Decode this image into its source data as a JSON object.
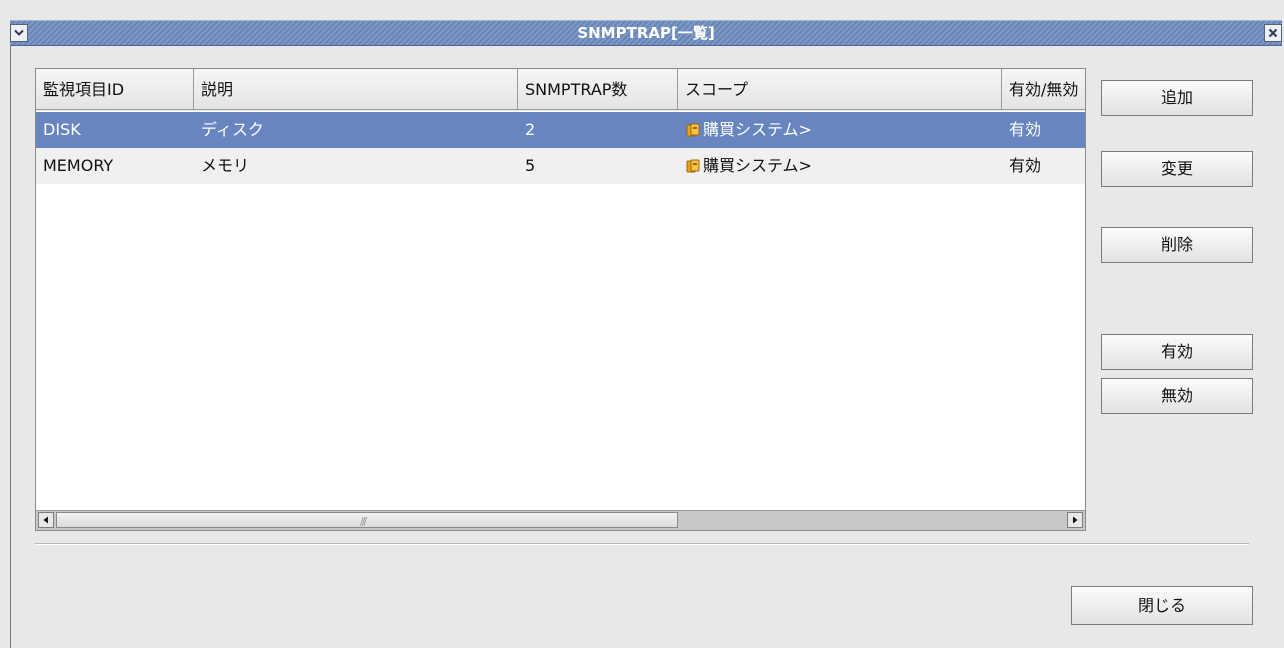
{
  "window": {
    "title": "SNMPTRAP[一覧]"
  },
  "table": {
    "columns": [
      "監視項目ID",
      "説明",
      "SNMPTRAP数",
      "スコープ",
      "有効/無効"
    ],
    "rows": [
      {
        "id": "DISK",
        "desc": "ディスク",
        "count": "2",
        "scope": "購買システム>",
        "status": "有効",
        "selected": true
      },
      {
        "id": "MEMORY",
        "desc": "メモリ",
        "count": "5",
        "scope": "購買システム>",
        "status": "有効",
        "selected": false
      }
    ]
  },
  "buttons": {
    "add": "追加",
    "modify": "変更",
    "delete": "削除",
    "enable": "有効",
    "disable": "無効",
    "close": "閉じる"
  },
  "colors": {
    "selection": "#6785c0",
    "titlebar": "#6f8dc0",
    "scope_icon": "#e8a317"
  },
  "icons": {
    "window_menu": "chevron-down-icon",
    "window_close": "close-icon",
    "scope": "folder-node-icon",
    "scroll_left": "arrow-left-icon",
    "scroll_right": "arrow-right-icon"
  }
}
